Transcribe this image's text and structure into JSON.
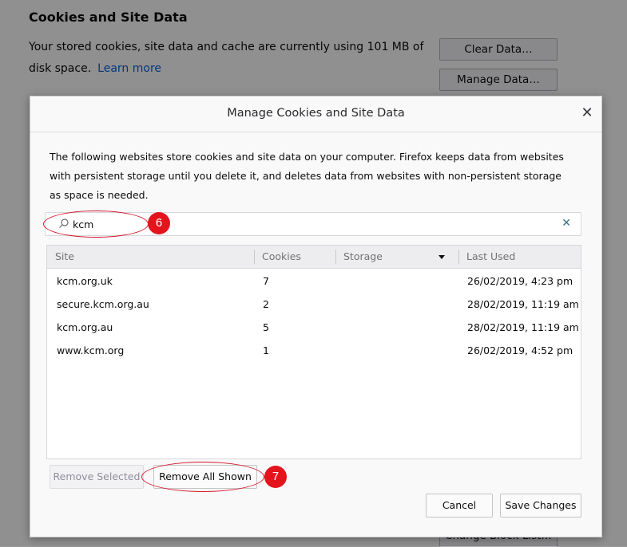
{
  "background": {
    "section_title": "Cookies and Site Data",
    "description": "Your stored cookies, site data and cache are currently using 101 MB of disk space.",
    "learn_more": "Learn more",
    "clear_data_label": "Clear Data…",
    "manage_data_label": "Manage Data…",
    "block_list_label": "Change Block List…"
  },
  "dialog": {
    "title": "Manage Cookies and Site Data",
    "description": "The following websites store cookies and site data on your computer. Firefox keeps data from websites with persistent storage until you delete it, and deletes data from websites with non-persistent storage as space is needed.",
    "search": {
      "value": "kcm",
      "placeholder": ""
    },
    "columns": {
      "site": "Site",
      "cookies": "Cookies",
      "storage": "Storage",
      "last_used": "Last Used"
    },
    "rows": [
      {
        "site": "kcm.org.uk",
        "cookies": "7",
        "storage": "",
        "last_used": "26/02/2019, 4:23 pm"
      },
      {
        "site": "secure.kcm.org.au",
        "cookies": "2",
        "storage": "",
        "last_used": "28/02/2019, 11:19 am"
      },
      {
        "site": "kcm.org.au",
        "cookies": "5",
        "storage": "",
        "last_used": "28/02/2019, 11:19 am"
      },
      {
        "site": "www.kcm.org",
        "cookies": "1",
        "storage": "",
        "last_used": "26/02/2019, 4:52 pm"
      }
    ],
    "remove_selected_label": "Remove Selected",
    "remove_all_shown_label": "Remove All Shown",
    "cancel_label": "Cancel",
    "save_changes_label": "Save Changes"
  },
  "annotations": {
    "step_search": "6",
    "step_remove": "7"
  },
  "colors": {
    "accent_link": "#0060df",
    "callout_red": "#e3141c",
    "clear_icon": "#3a7089"
  },
  "icons": {
    "search": "search-icon",
    "close": "close-icon",
    "clear": "clear-icon",
    "sort": "sort-down-icon"
  }
}
